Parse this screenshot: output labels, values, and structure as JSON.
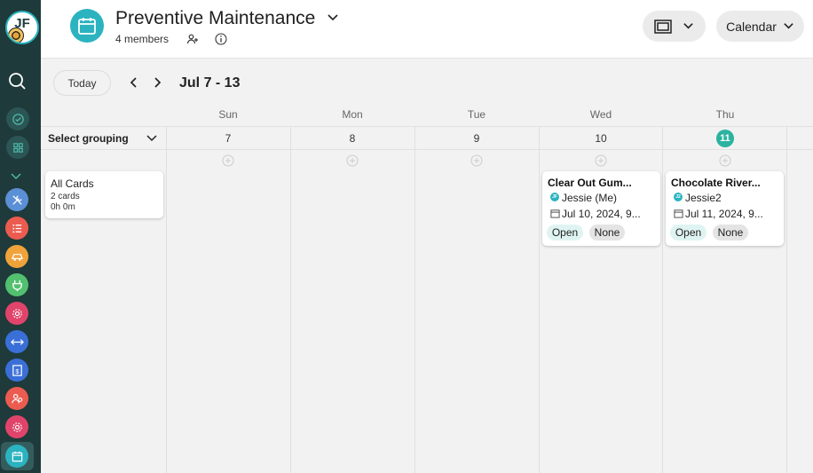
{
  "user": {
    "initials": "JF"
  },
  "board": {
    "title": "Preventive Maintenance",
    "members": "4 members"
  },
  "header": {
    "view_selector_label": "Calendar"
  },
  "toolbar": {
    "today_label": "Today",
    "date_range": "Jul 7 - 13"
  },
  "sidebar": {
    "apps": [
      {
        "icon": "tools-icon",
        "color": "#5b8fd6"
      },
      {
        "icon": "list-icon",
        "color": "#ec5b4f"
      },
      {
        "icon": "car-icon",
        "color": "#f0a33b"
      },
      {
        "icon": "plug-icon",
        "color": "#52c06f"
      },
      {
        "icon": "gear-icon",
        "color": "#e0446a"
      },
      {
        "icon": "arrows-icon",
        "color": "#3b6fd8"
      },
      {
        "icon": "dollar-icon",
        "color": "#3b6fd8"
      },
      {
        "icon": "people-icon",
        "color": "#ec5b4f"
      },
      {
        "icon": "gear-icon",
        "color": "#e0446a"
      },
      {
        "icon": "calendar-icon",
        "color": "#2bb3c0"
      }
    ]
  },
  "grouping": {
    "label": "Select grouping",
    "group_card": {
      "title": "All Cards",
      "count": "2 cards",
      "duration": "0h 0m"
    }
  },
  "days": [
    {
      "name": "Sun",
      "num": "7"
    },
    {
      "name": "Mon",
      "num": "8"
    },
    {
      "name": "Tue",
      "num": "9"
    },
    {
      "name": "Wed",
      "num": "10"
    },
    {
      "name": "Thu",
      "num": "11"
    }
  ],
  "cards": [
    {
      "title": "Clear Out Gum...",
      "assignee_initials": "JF",
      "assignee": "Jessie (Me)",
      "date": "Jul 10, 2024, 9...",
      "status": "Open",
      "priority": "None"
    },
    {
      "title": "Chocolate River...",
      "assignee_initials": "J2",
      "assignee": "Jessie2",
      "date": "Jul 11, 2024, 9...",
      "status": "Open",
      "priority": "None"
    }
  ],
  "colors": {
    "accent": "#2bb3c0",
    "sidebar_bg": "#1e3a3a",
    "today": "#2bb3a0"
  }
}
